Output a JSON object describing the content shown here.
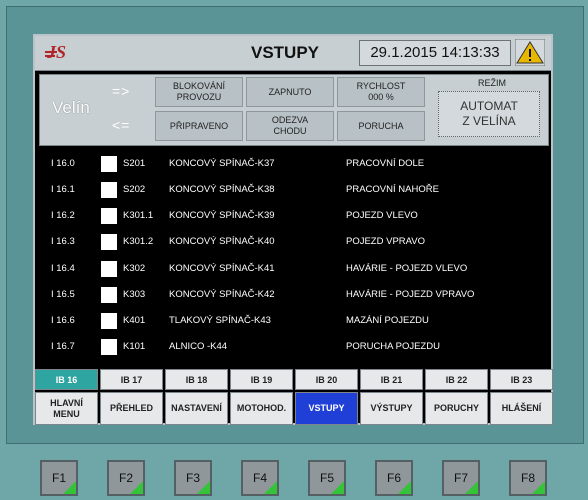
{
  "header": {
    "title": "VSTUPY",
    "datetime": "29.1.2015 14:13:33"
  },
  "status_panel": {
    "station": "Velín",
    "arrow_out": "=>",
    "arrow_in": "<=",
    "buttons": [
      {
        "label": "BLOKOVÁNÍ\nPROVOZU"
      },
      {
        "label": "ZAPNUTO"
      },
      {
        "label": "RYCHLOST\n000    %"
      },
      {
        "label": "PŘIPRAVENO"
      },
      {
        "label": "ODEZVA\nCHODU"
      },
      {
        "label": "PORUCHA"
      }
    ],
    "mode_label": "REŽIM",
    "mode_value": "AUTOMAT\nZ VELÍNA"
  },
  "inputs": [
    {
      "addr": "I 16.0",
      "tag": "S201",
      "device": "KONCOVÝ SPÍNAČ-K37",
      "desc": "PRACOVNÍ DOLE"
    },
    {
      "addr": "I 16.1",
      "tag": "S202",
      "device": "KONCOVÝ SPÍNAČ-K38",
      "desc": "PRACOVNÍ NAHOŘE"
    },
    {
      "addr": "I 16.2",
      "tag": "K301.1",
      "device": "KONCOVÝ SPÍNAČ-K39",
      "desc": "POJEZD VLEVO"
    },
    {
      "addr": "I 16.3",
      "tag": "K301.2",
      "device": "KONCOVÝ SPÍNAČ-K40",
      "desc": "POJEZD VPRAVO"
    },
    {
      "addr": "I 16.4",
      "tag": "K302",
      "device": "KONCOVÝ SPÍNAČ-K41",
      "desc": "HAVÁRIE - POJEZD VLEVO"
    },
    {
      "addr": "I 16.5",
      "tag": "K303",
      "device": "KONCOVÝ SPÍNAČ-K42",
      "desc": "HAVÁRIE - POJEZD VPRAVO"
    },
    {
      "addr": "I 16.6",
      "tag": "K401",
      "device": "TLAKOVÝ  SPÍNAČ-K43",
      "desc": "MAZÁNÍ POJEZDU"
    },
    {
      "addr": "I 16.7",
      "tag": "K101",
      "device": "ALNICO           -K44",
      "desc": "PORUCHA POJEZDU"
    }
  ],
  "ib_tabs": [
    "IB 16",
    "IB 17",
    "IB 18",
    "IB 19",
    "IB 20",
    "IB 21",
    "IB 22",
    "IB 23"
  ],
  "nav": [
    "HLAVNÍ\nMENU",
    "PŘEHLED",
    "NASTAVENÍ",
    "MOTOHOD.",
    "VSTUPY",
    "VÝSTUPY",
    "PORUCHY",
    "HLÁŠENÍ"
  ],
  "fkeys": [
    "F1",
    "F2",
    "F3",
    "F4",
    "F5",
    "F6",
    "F7",
    "F8"
  ],
  "colors": {
    "active_tab": "#2fa5a1",
    "active_nav": "#1f3fd6",
    "fkey_accent": "#35c33a",
    "warning": "#e8b800"
  },
  "icons": {
    "logo": "company-logo",
    "warning": "warning-triangle-icon"
  }
}
